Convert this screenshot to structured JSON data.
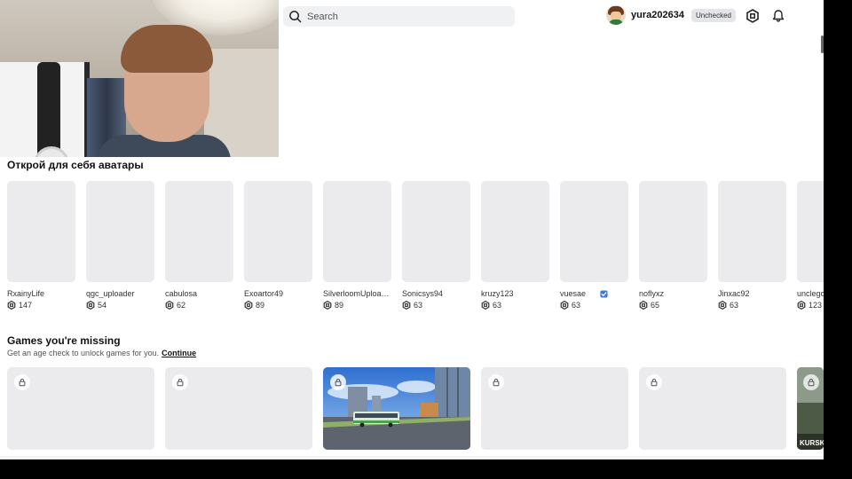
{
  "header": {
    "search_placeholder": "Search",
    "username": "yura202634",
    "account_badge": "Unchecked"
  },
  "avatars_section": {
    "title": "Открой для себя аватары",
    "items": [
      {
        "name": "RxainyLife",
        "count": "147",
        "verified": false
      },
      {
        "name": "qgc_uploader",
        "count": "54",
        "verified": false
      },
      {
        "name": "cabulosa",
        "count": "62",
        "verified": false
      },
      {
        "name": "Exoartor49",
        "count": "89",
        "verified": false
      },
      {
        "name": "SilverloomUploa…",
        "count": "89",
        "verified": false
      },
      {
        "name": "Sonicsys94",
        "count": "63",
        "verified": false
      },
      {
        "name": "kruzy123",
        "count": "63",
        "verified": false
      },
      {
        "name": "vuesae",
        "count": "63",
        "verified": true
      },
      {
        "name": "noflyxz",
        "count": "65",
        "verified": false
      },
      {
        "name": "Jinxac92",
        "count": "63",
        "verified": false
      },
      {
        "name": "unclego",
        "count": "123",
        "verified": false
      }
    ]
  },
  "games_section": {
    "title": "Games you're missing",
    "subtitle": "Get an age check to unlock games for you.",
    "continue_link": "Continue",
    "cards": [
      {
        "kind": "placeholder"
      },
      {
        "kind": "placeholder"
      },
      {
        "kind": "bus-scene"
      },
      {
        "kind": "placeholder"
      },
      {
        "kind": "placeholder"
      },
      {
        "kind": "kursk",
        "label": "KURSK"
      }
    ]
  },
  "colors": {
    "tile": "#ebebed",
    "search_bg": "#f0f1f3",
    "verified": "#3b7be0"
  }
}
